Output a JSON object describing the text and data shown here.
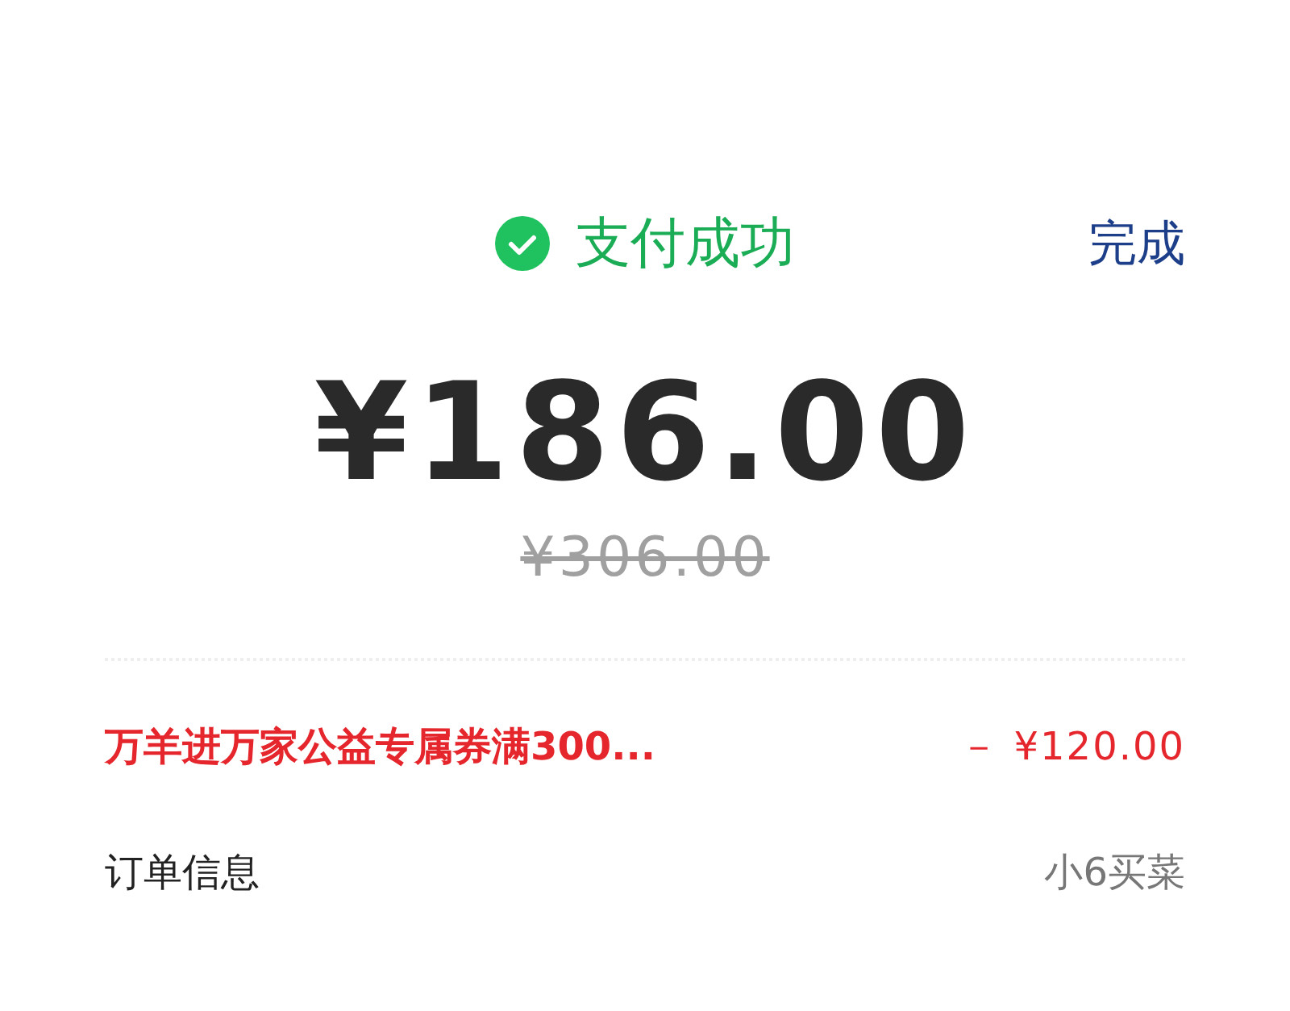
{
  "header": {
    "status": {
      "text": "支付成功"
    },
    "done_button": "完成"
  },
  "amount": "¥186.00",
  "original_amount": "¥306.00",
  "rows": [
    {
      "kind": "discount",
      "label": "万羊进万家公益专属券满300...",
      "value": "－ ¥120.00"
    },
    {
      "kind": "info",
      "label": "订单信息",
      "value": "小6买菜"
    }
  ]
}
